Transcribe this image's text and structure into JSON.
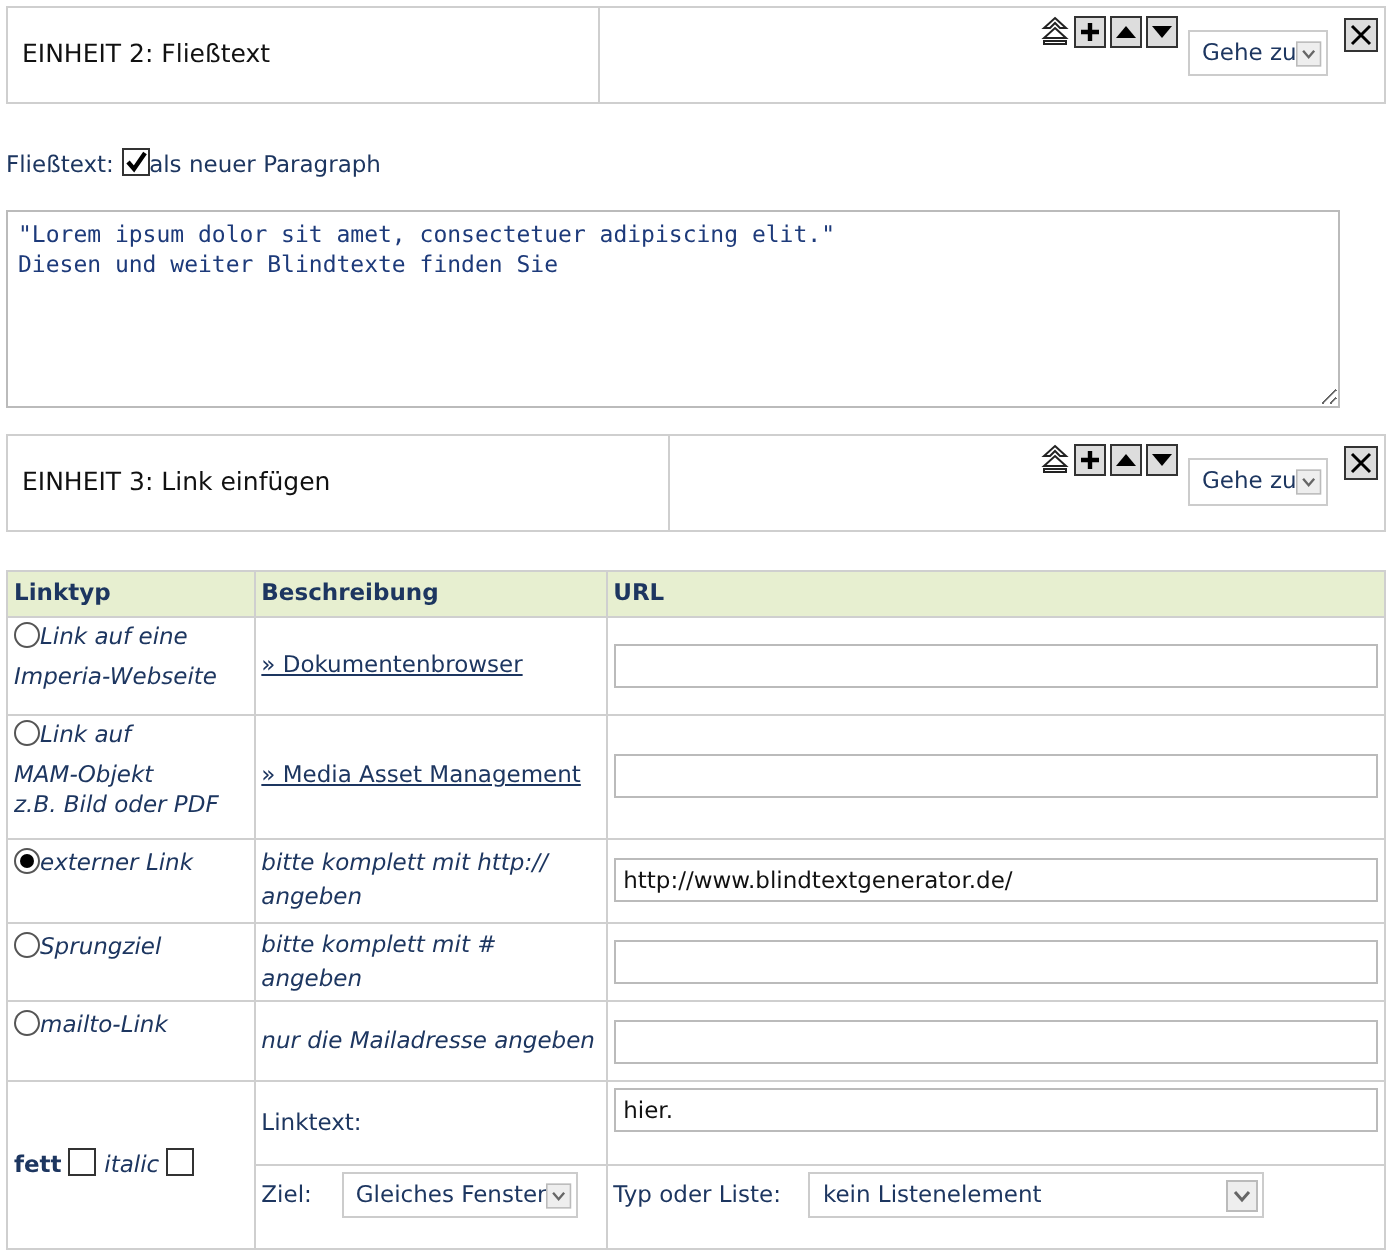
{
  "unit_2": {
    "title": "EINHEIT 2: Fließtext",
    "goto": "Gehe zu"
  },
  "paragraph_option": {
    "label": "Fließtext:",
    "checkbox_label": "als neuer Paragraph",
    "checked": true
  },
  "text_area": {
    "value": "\"Lorem ipsum dolor sit amet, consectetuer adipiscing elit.\"\nDiesen und weiter Blindtexte finden Sie"
  },
  "unit_3": {
    "title": "EINHEIT 3: Link einfügen",
    "goto": "Gehe zu"
  },
  "link_table": {
    "columns": [
      "Linktyp",
      "Beschreibung",
      "URL"
    ],
    "rows": [
      {
        "label_lines": [
          "Link auf eine",
          "Imperia-Webseite"
        ],
        "selected": false,
        "description": "» Dokumentenbrowser",
        "kind": "link",
        "url": ""
      },
      {
        "label_lines": [
          "Link auf",
          "MAM-Objekt",
          "z.B. Bild oder PDF"
        ],
        "selected": false,
        "description": "» Media Asset Management",
        "kind": "link",
        "url": ""
      },
      {
        "label_lines": [
          "externer Link"
        ],
        "selected": true,
        "description": "bitte komplett mit http:// angeben",
        "kind": "note",
        "url": "http://www.blindtextgenerator.de/"
      },
      {
        "label_lines": [
          "Sprungziel"
        ],
        "selected": false,
        "description": "bitte komplett mit # angeben",
        "kind": "note",
        "url": ""
      },
      {
        "label_lines": [
          "mailto-Link"
        ],
        "selected": false,
        "description": "nur die Mailadresse angeben",
        "kind": "note",
        "url": ""
      }
    ],
    "format": {
      "bold_label": "fett",
      "bold_checked": false,
      "italic_label": "italic",
      "italic_checked": false,
      "link_text_label": "Linktext:",
      "link_text": "hier.",
      "target_label": "Ziel:",
      "target": "Gleiches Fenster",
      "list_type_label": "Typ oder Liste:",
      "list_type": "kein Listenelement"
    }
  }
}
